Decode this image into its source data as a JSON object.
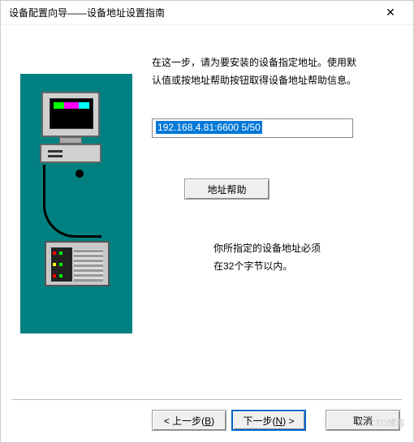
{
  "window": {
    "title": "设备配置向导——设备地址设置指南"
  },
  "instruction": {
    "line1": "在这一步，请为要安装的设备指定地址。使用默",
    "line2": "认值或按地址帮助按钮取得设备地址帮助信息。"
  },
  "address": {
    "value": "192.168.4.81:6600 5/50"
  },
  "help_button": {
    "label": "地址帮助"
  },
  "note": {
    "line1": "你所指定的设备地址必须",
    "line2": "在32个字节以内。"
  },
  "buttons": {
    "back": "< 上一步(",
    "back_key": "B",
    "back_end": ")",
    "next": "下一步(",
    "next_key": "N",
    "next_end": ") >",
    "cancel": "取消"
  },
  "watermark": "51CTO博客"
}
